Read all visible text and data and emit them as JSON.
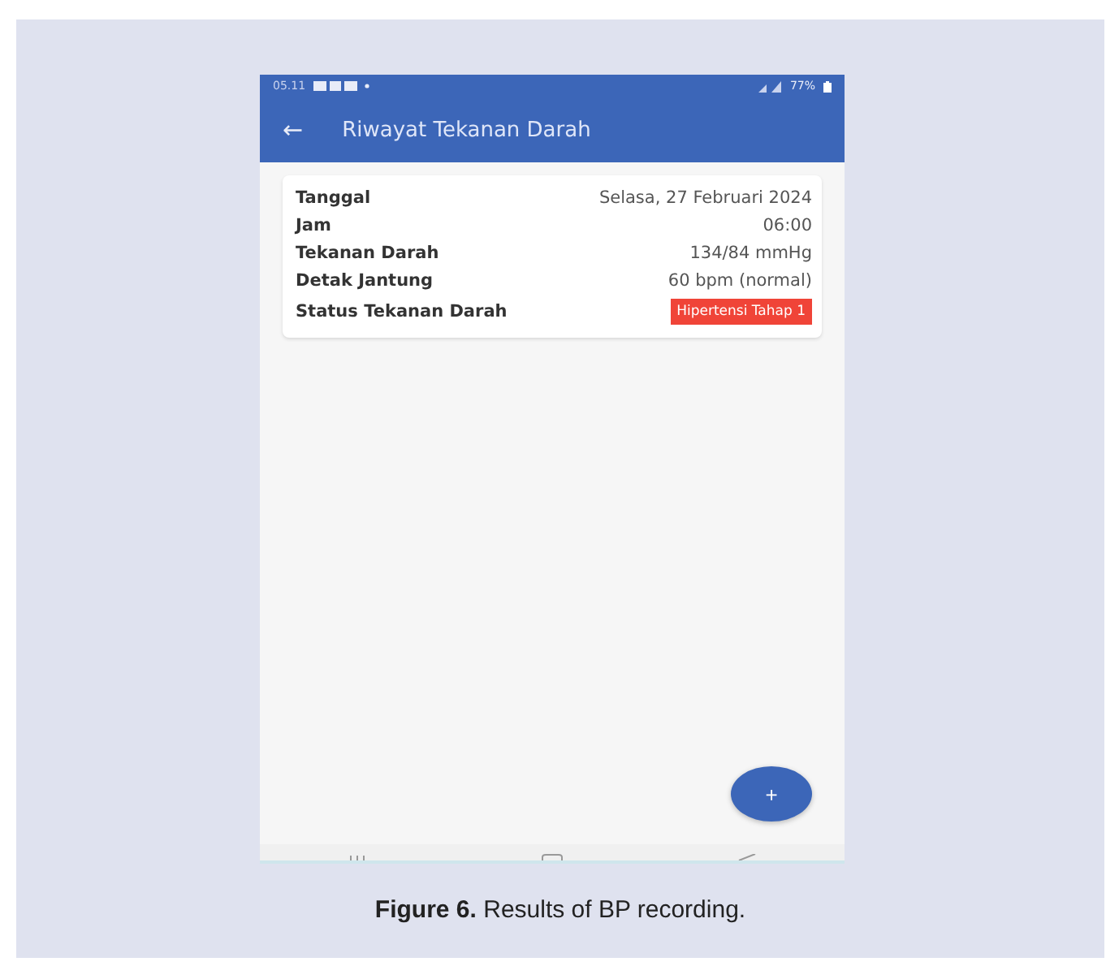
{
  "status_bar": {
    "time": "05.11",
    "battery": "77%"
  },
  "app_bar": {
    "back": "←",
    "title": "Riwayat Tekanan Darah"
  },
  "record": {
    "rows": [
      {
        "label": "Tanggal",
        "value": "Selasa, 27 Februari 2024",
        "kind": "text"
      },
      {
        "label": "Jam",
        "value": "06:00",
        "kind": "text"
      },
      {
        "label": "Tekanan Darah",
        "value": "134/84 mmHg",
        "kind": "text"
      },
      {
        "label": "Detak Jantung",
        "value": "60 bpm (normal)",
        "kind": "text"
      },
      {
        "label": "Status Tekanan Darah",
        "value": "Hipertensi Tahap 1",
        "kind": "badge",
        "color": "#f04438"
      }
    ]
  },
  "fab": "+",
  "caption": "**Figure 6.** Results of BP recording."
}
